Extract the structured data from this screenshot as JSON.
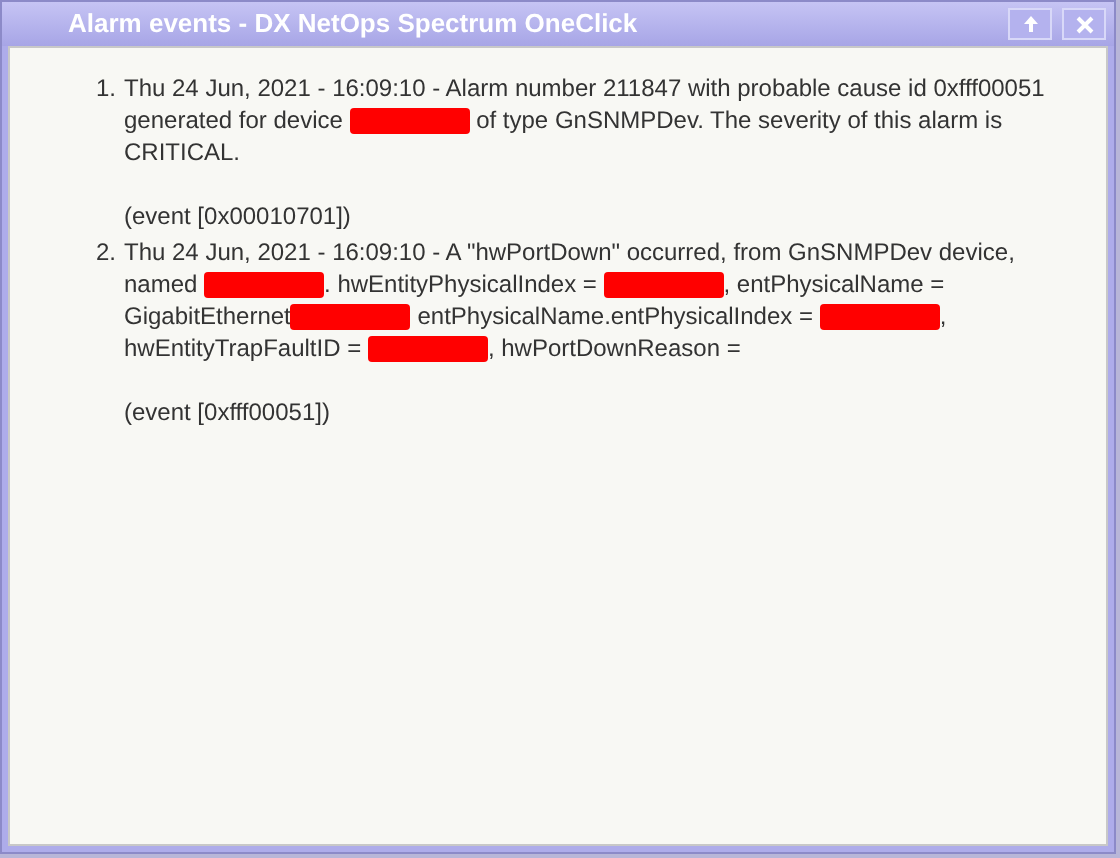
{
  "window": {
    "title": "Alarm events - DX NetOps Spectrum OneClick"
  },
  "events": [
    {
      "number": "1.",
      "segments": [
        {
          "kind": "text",
          "text": "Thu 24 Jun, 2021 - 16:09:10 - Alarm number 211847 with probable cause id 0xfff00051 generated for device "
        },
        {
          "kind": "redacted"
        },
        {
          "kind": "text",
          "text": " of type GnSNMPDev. The severity of this alarm is CRITICAL."
        }
      ],
      "event_id": "(event [0x00010701])"
    },
    {
      "number": "2.",
      "segments": [
        {
          "kind": "text",
          "text": "Thu 24 Jun, 2021 - 16:09:10 - A \"hwPortDown\" occurred, from GnSNMPDev device, named "
        },
        {
          "kind": "redacted"
        },
        {
          "kind": "text",
          "text": ". hwEntityPhysicalIndex = "
        },
        {
          "kind": "redacted"
        },
        {
          "kind": "text",
          "text": ", entPhysicalName = GigabitEthernet"
        },
        {
          "kind": "redacted"
        },
        {
          "kind": "text",
          "text": " entPhysicalName.entPhysicalIndex = "
        },
        {
          "kind": "redacted"
        },
        {
          "kind": "text",
          "text": ", hwEntityTrapFaultID = "
        },
        {
          "kind": "redacted"
        },
        {
          "kind": "text",
          "text": ", hwPortDownReason ="
        }
      ],
      "event_id": "(event [0xfff00051])"
    }
  ]
}
